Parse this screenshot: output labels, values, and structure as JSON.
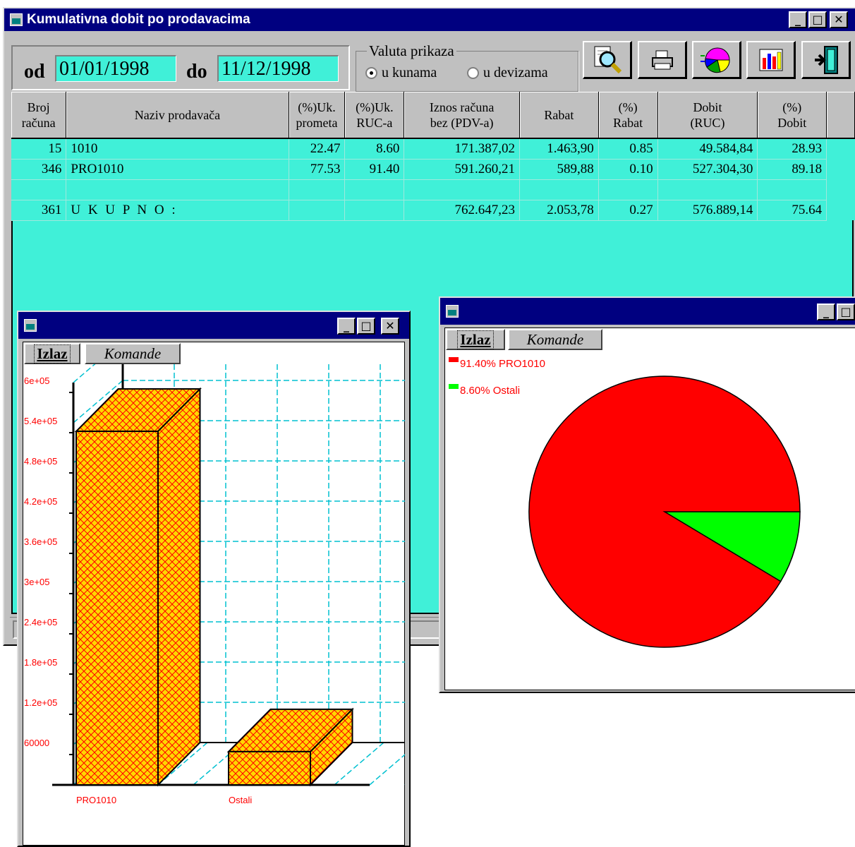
{
  "main_window": {
    "title": "Kumulativna dobit po prodavacima",
    "date_from_label": "od",
    "date_from": "01/01/1998",
    "date_to_label": "do",
    "date_to": "11/12/1998",
    "currency_group_label": "Valuta prikaza",
    "currency_options": [
      "u kunama",
      "u devizama"
    ],
    "currency_selected": "u kunama"
  },
  "table": {
    "headers": [
      [
        "Broj",
        "računa"
      ],
      [
        "Naziv prodavača"
      ],
      [
        "(%)Uk.",
        "prometa"
      ],
      [
        "(%)Uk.",
        "RUC-a"
      ],
      [
        "Iznos računa",
        "bez (PDV-a)"
      ],
      [
        "Rabat"
      ],
      [
        "(%)",
        "Rabat"
      ],
      [
        "Dobit",
        "(RUC)"
      ],
      [
        "(%)",
        "Dobit"
      ]
    ],
    "rows": [
      [
        "15",
        "1010",
        "22.47",
        "8.60",
        "171.387,02",
        "1.463,90",
        "0.85",
        "49.584,84",
        "28.93"
      ],
      [
        "346",
        "PRO1010",
        "77.53",
        "91.40",
        "591.260,21",
        "589,88",
        "0.10",
        "527.304,30",
        "89.18"
      ],
      [
        "",
        "",
        "",
        "",
        "",
        "",
        "",
        "",
        ""
      ],
      [
        "361",
        "U K U P N O :",
        "",
        "",
        "762.647,23",
        "2.053,78",
        "0.27",
        "576.889,14",
        "75.64"
      ]
    ]
  },
  "bar_window": {
    "exit_label": "Izlaz",
    "commands_label": "Komande"
  },
  "pie_window": {
    "exit_label": "Izlaz",
    "commands_label": "Komande"
  },
  "chart_data": [
    {
      "type": "bar",
      "categories": [
        "PRO1010",
        "Ostali"
      ],
      "values": [
        527304.3,
        49584.84
      ],
      "ylim": [
        0,
        600000
      ],
      "yticks": [
        "60000",
        "1.2e+05",
        "1.8e+05",
        "2.4e+05",
        "3e+05",
        "3.6e+05",
        "4.2e+05",
        "4.8e+05",
        "5.4e+05",
        "6e+05"
      ],
      "grid": true,
      "colors": {
        "fill": "#ffd700",
        "hatch": "#ff0000",
        "grid": "#00c0d0"
      }
    },
    {
      "type": "pie",
      "labels": [
        "91.40% PRO1010",
        "8.60% Ostali"
      ],
      "values": [
        91.4,
        8.6
      ],
      "colors": [
        "#ff0000",
        "#00ff00"
      ],
      "legend": "top-left"
    }
  ]
}
